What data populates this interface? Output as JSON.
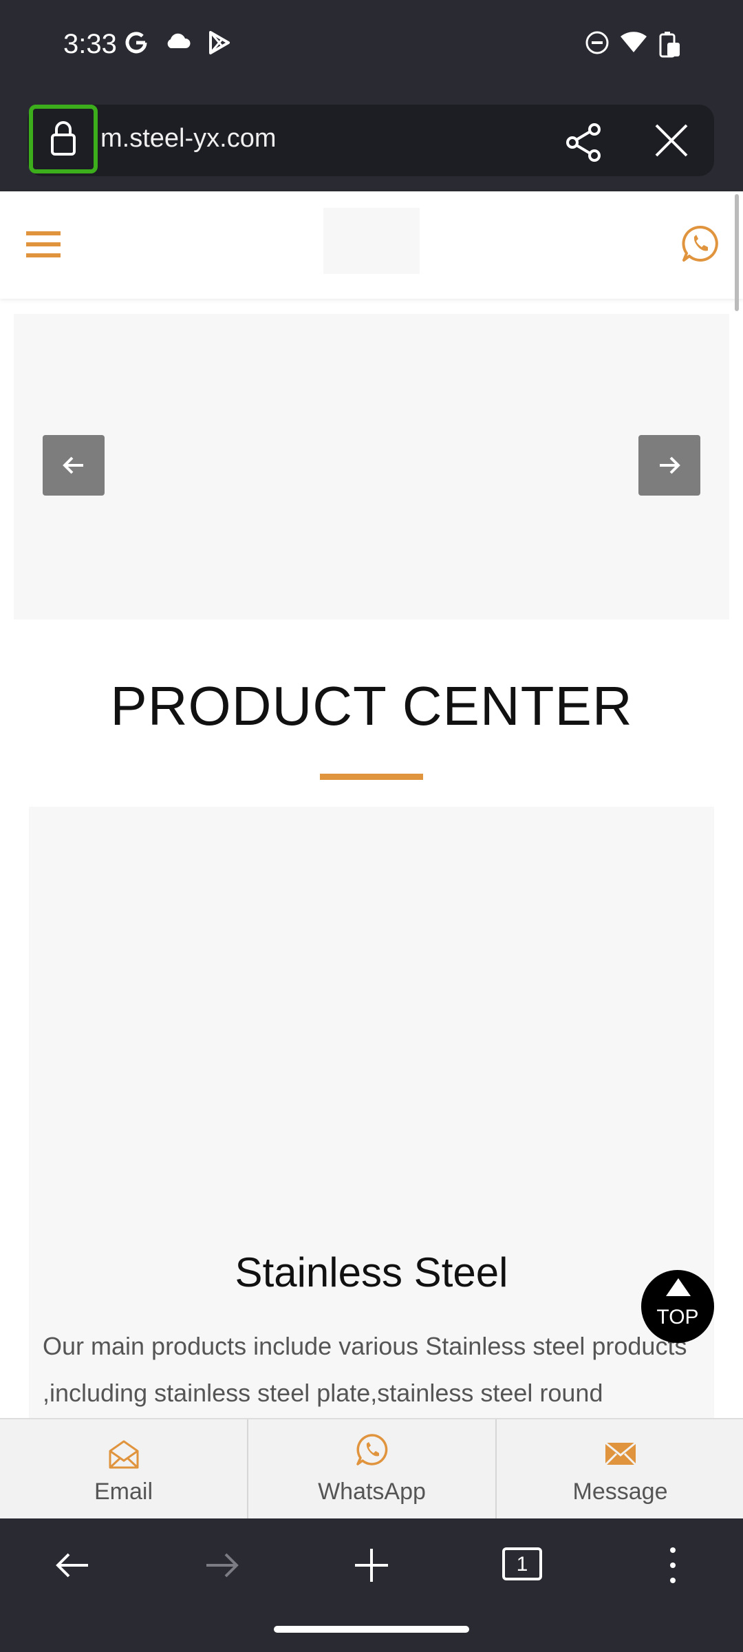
{
  "status_bar": {
    "time": "3:33",
    "left_icons": [
      "google-icon",
      "cloud-icon",
      "play-store-icon"
    ],
    "right_icons": [
      "do-not-disturb-icon",
      "wifi-icon",
      "battery-charging-icon"
    ]
  },
  "browser": {
    "url": "m.steel-yx.com",
    "lock_icon": "lock-icon",
    "share_icon": "share-icon",
    "close_icon": "close-icon",
    "highlight_color": "#3cae1c"
  },
  "site": {
    "accent_color": "#e0943e",
    "menu_icon": "hamburger-menu-icon",
    "header_contact_icon": "whatsapp-icon"
  },
  "slider": {
    "prev_icon": "arrow-left-icon",
    "next_icon": "arrow-right-icon"
  },
  "product_center": {
    "title": "PRODUCT CENTER",
    "product_name": "Stainless Steel",
    "description": "Our main products include various Stainless steel products ,including stainless steel plate,stainless steel round"
  },
  "top_button": {
    "label": "TOP"
  },
  "contact_bar": {
    "items": [
      {
        "label": "Email",
        "icon": "email-icon"
      },
      {
        "label": "WhatsApp",
        "icon": "whatsapp-icon"
      },
      {
        "label": "Message",
        "icon": "message-icon"
      }
    ]
  },
  "nav_bar": {
    "tab_count": "1",
    "icons": [
      "back-icon",
      "forward-icon",
      "new-tab-icon",
      "tab-switcher-icon",
      "more-options-icon"
    ]
  }
}
